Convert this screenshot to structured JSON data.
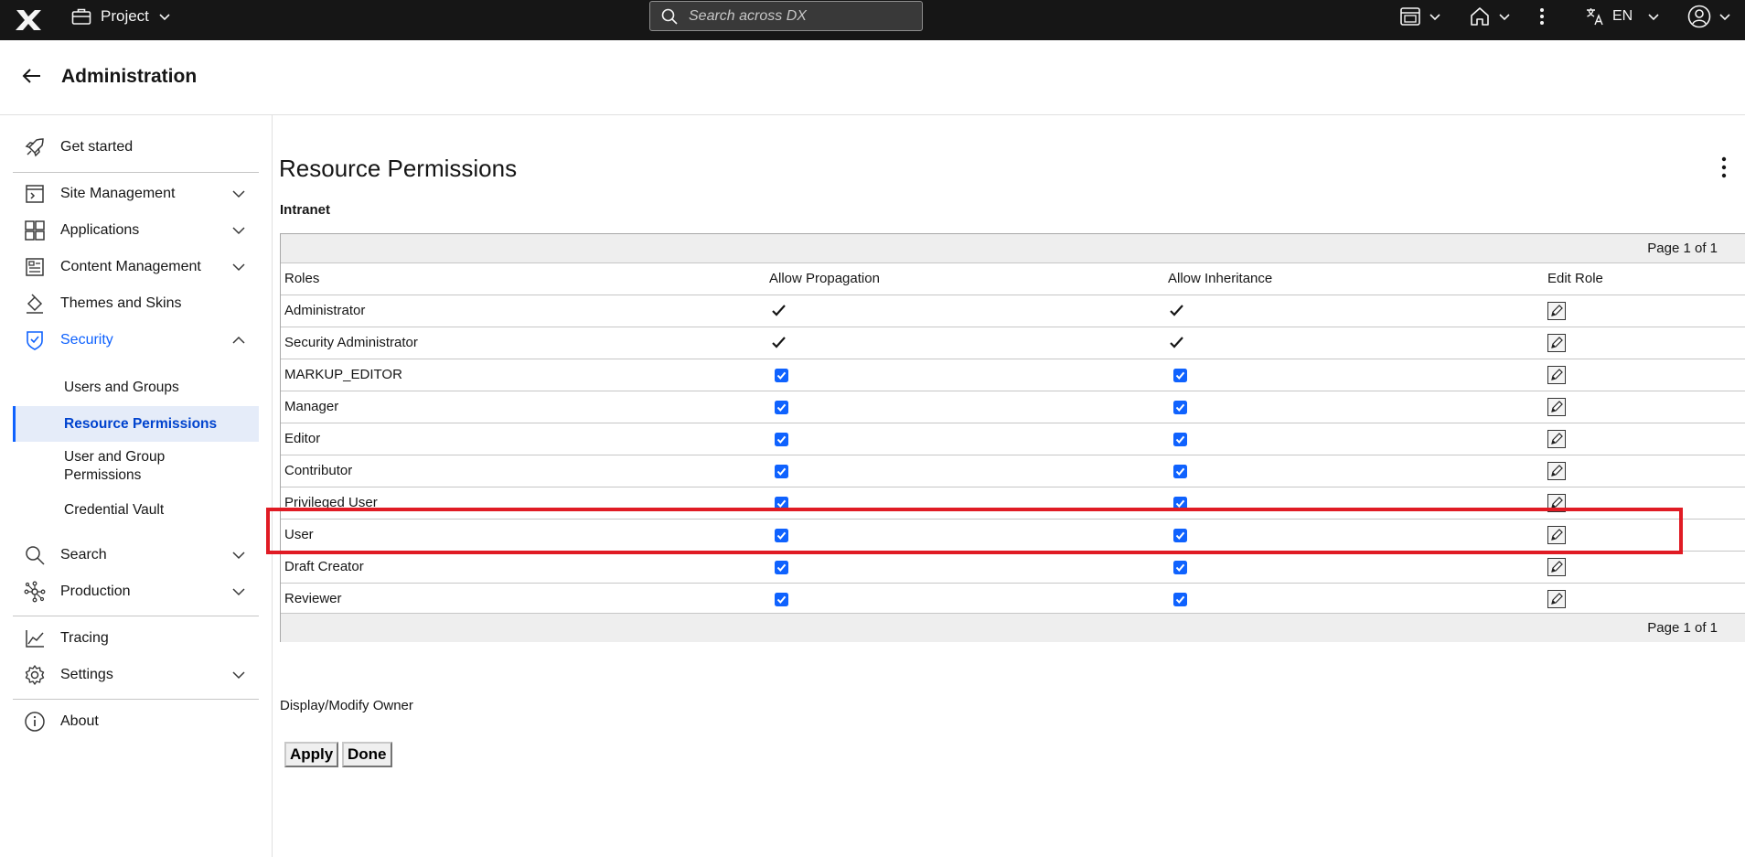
{
  "topbar": {
    "project_label": "Project",
    "search_placeholder": "Search across DX",
    "language": "EN"
  },
  "header": {
    "title": "Administration"
  },
  "sidebar": {
    "items": [
      {
        "label": "Get started",
        "icon": "rocket-icon"
      },
      {
        "label": "Site Management",
        "icon": "site-icon"
      },
      {
        "label": "Applications",
        "icon": "apps-icon"
      },
      {
        "label": "Content Management",
        "icon": "content-icon"
      },
      {
        "label": "Themes and Skins",
        "icon": "paint-bucket-icon"
      },
      {
        "label": "Security",
        "icon": "shield-check-icon"
      },
      {
        "label": "Search",
        "icon": "search-icon"
      },
      {
        "label": "Production",
        "icon": "network-icon"
      },
      {
        "label": "Tracing",
        "icon": "chart-line-icon"
      },
      {
        "label": "Settings",
        "icon": "gear-icon"
      },
      {
        "label": "About",
        "icon": "info-icon"
      }
    ],
    "security_sub": [
      "Users and Groups",
      "Resource Permissions",
      "User and Group Permissions",
      "Credential Vault"
    ]
  },
  "main": {
    "title": "Resource Permissions",
    "resource": "Intranet",
    "pager_text": "Page 1 of 1",
    "columns": [
      "Roles",
      "Allow Propagation",
      "Allow Inheritance",
      "Edit Role"
    ],
    "rows": [
      {
        "role": "Administrator",
        "propagation": "fixed",
        "inheritance": "fixed"
      },
      {
        "role": "Security Administrator",
        "propagation": "fixed",
        "inheritance": "fixed"
      },
      {
        "role": "MARKUP_EDITOR",
        "propagation": true,
        "inheritance": true
      },
      {
        "role": "Manager",
        "propagation": true,
        "inheritance": true
      },
      {
        "role": "Editor",
        "propagation": true,
        "inheritance": true
      },
      {
        "role": "Contributor",
        "propagation": true,
        "inheritance": true
      },
      {
        "role": "Privileged User",
        "propagation": true,
        "inheritance": true
      },
      {
        "role": "User",
        "propagation": true,
        "inheritance": true
      },
      {
        "role": "Draft Creator",
        "propagation": true,
        "inheritance": true
      },
      {
        "role": "Reviewer",
        "propagation": true,
        "inheritance": true
      }
    ],
    "owner_label": "Display/Modify Owner",
    "apply_label": "Apply",
    "done_label": "Done"
  },
  "colors": {
    "accent": "#0f62fe",
    "highlight": "#e01b24",
    "topbar": "#161616"
  }
}
